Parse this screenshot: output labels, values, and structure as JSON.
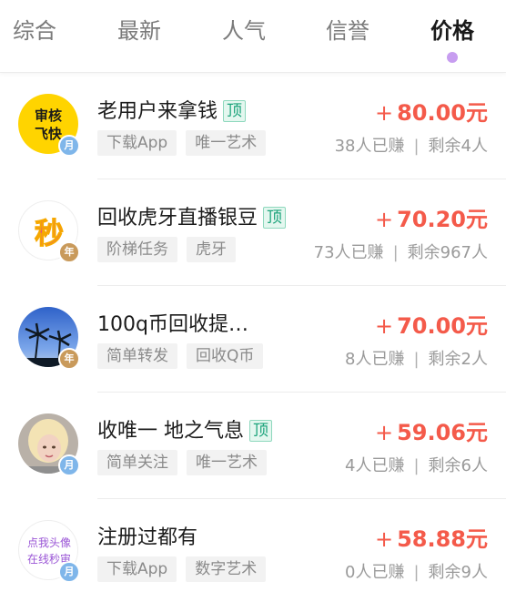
{
  "tabs": [
    {
      "label": "综合"
    },
    {
      "label": "最新"
    },
    {
      "label": "人气"
    },
    {
      "label": "信誉"
    },
    {
      "label": "价格"
    }
  ],
  "colors": {
    "active_dot": "#c79df0",
    "price": "#f45a4a",
    "top_tag": "#1aa37a"
  },
  "tasks": [
    {
      "avatar_text": "审核飞快",
      "avatar_lines": [
        "审核",
        "飞快"
      ],
      "avatar_icon": "yellow-text-avatar",
      "badge": "月",
      "title": "老用户来拿钱",
      "top": "顶",
      "tags": [
        "下载App",
        "唯一艺术"
      ],
      "price_prefix": "+",
      "price": "80.00元",
      "earned": "38人已赚",
      "remaining": "剩余4人"
    },
    {
      "avatar_text": "秒",
      "avatar_icon": "calligraphy-avatar",
      "badge": "年",
      "title": "回收虎牙直播银豆",
      "top": "顶",
      "tags": [
        "阶梯任务",
        "虎牙"
      ],
      "price_prefix": "+",
      "price": "70.20元",
      "earned": "73人已赚",
      "remaining": "剩余967人"
    },
    {
      "avatar_icon": "palm-tree-sunset-avatar",
      "badge": "年",
      "title": "100q币回收提…",
      "top": "",
      "tags": [
        "简单转发",
        "回收Q币"
      ],
      "price_prefix": "+",
      "price": "70.00元",
      "earned": "8人已赚",
      "remaining": "剩余2人"
    },
    {
      "avatar_icon": "photo-person-avatar",
      "badge": "月",
      "title": "收唯一 地之气息",
      "top": "顶",
      "tags": [
        "简单关注",
        "唯一艺术"
      ],
      "price_prefix": "+",
      "price": "59.06元",
      "earned": "4人已赚",
      "remaining": "剩余6人"
    },
    {
      "avatar_text": "点我头像在线秒审",
      "avatar_lines": [
        "点我头像",
        "在线秒审"
      ],
      "avatar_icon": "text-avatar",
      "badge": "月",
      "title": "注册过都有",
      "top": "",
      "tags": [
        "下载App",
        "数字艺术"
      ],
      "price_prefix": "+",
      "price": "58.88元",
      "earned": "0人已赚",
      "remaining": "剩余9人"
    }
  ]
}
